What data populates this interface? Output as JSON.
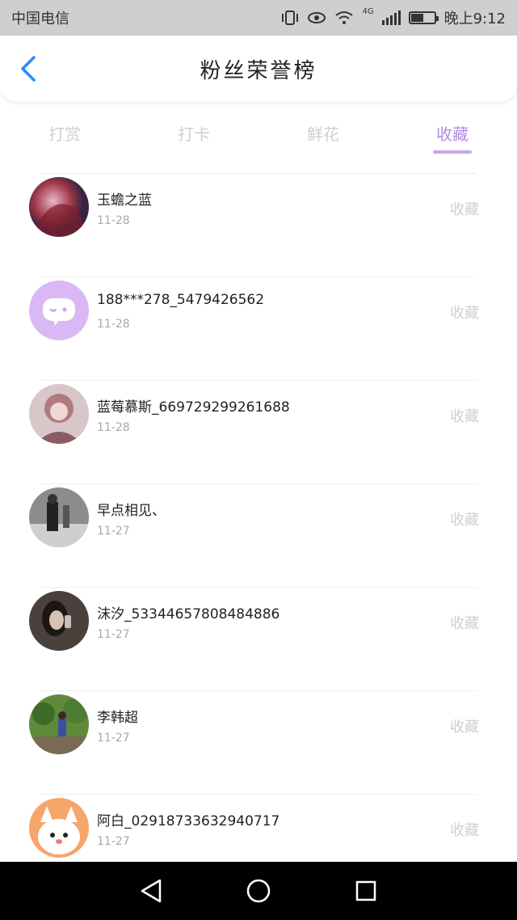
{
  "status_bar": {
    "carrier": "中国电信",
    "network": "4G",
    "time": "晚上9:12",
    "battery_level": 0.55
  },
  "header": {
    "title": "粉丝荣誉榜",
    "back_icon": "chevron-left-icon",
    "accent_color": "#2a8cf0"
  },
  "tabs": [
    {
      "label": "打赏",
      "active": false
    },
    {
      "label": "打卡",
      "active": false
    },
    {
      "label": "鲜花",
      "active": false
    },
    {
      "label": "收藏",
      "active": true
    }
  ],
  "active_color": "#b08be0",
  "fans": [
    {
      "name": "玉蟾之蓝",
      "date": "11-28",
      "action": "收藏",
      "avatar": "avatar-photo"
    },
    {
      "name": "188***278_5479426562",
      "date": "11-28",
      "action": "收藏",
      "avatar": "avatar-default-chat"
    },
    {
      "name": "蓝莓慕斯_669729299261688",
      "date": "11-28",
      "action": "收藏",
      "avatar": "avatar-photo"
    },
    {
      "name": "早点相见、",
      "date": "11-27",
      "action": "收藏",
      "avatar": "avatar-photo"
    },
    {
      "name": "沫汐_53344657808484886",
      "date": "11-27",
      "action": "收藏",
      "avatar": "avatar-photo"
    },
    {
      "name": "李韩超",
      "date": "11-27",
      "action": "收藏",
      "avatar": "avatar-photo"
    },
    {
      "name": "阿白_02918733632940717",
      "date": "11-27",
      "action": "收藏",
      "avatar": "avatar-cartoon"
    }
  ],
  "nav_bar": {
    "back": "back-triangle-icon",
    "home": "home-circle-icon",
    "recent": "recent-square-icon"
  }
}
